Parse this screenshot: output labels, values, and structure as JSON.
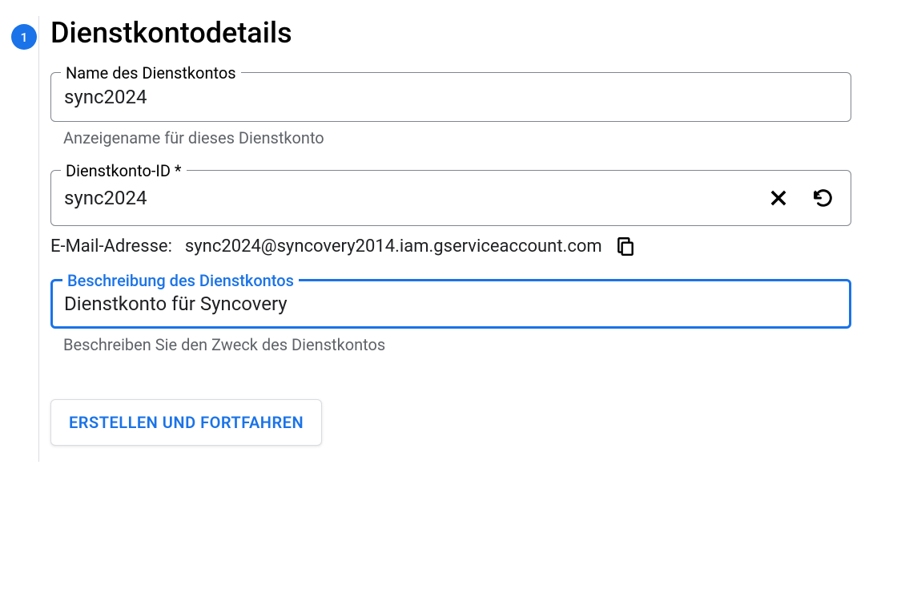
{
  "step": {
    "number": "1",
    "heading": "Dienstkontodetails"
  },
  "fields": {
    "name": {
      "label": "Name des Dienstkontos",
      "value": "sync2024",
      "helper": "Anzeigename für dieses Dienstkonto"
    },
    "id": {
      "label": "Dienstkonto-ID *",
      "value": "sync2024"
    },
    "description": {
      "label": "Beschreibung des Dienstkontos",
      "value": "Dienstkonto für Syncovery",
      "helper": "Beschreiben Sie den Zweck des Dienstkontos"
    }
  },
  "email": {
    "label": "E-Mail-Adresse:",
    "value": "sync2024@syncovery2014.iam.gserviceaccount.com"
  },
  "actions": {
    "create": "ERSTELLEN UND FORTFAHREN"
  }
}
